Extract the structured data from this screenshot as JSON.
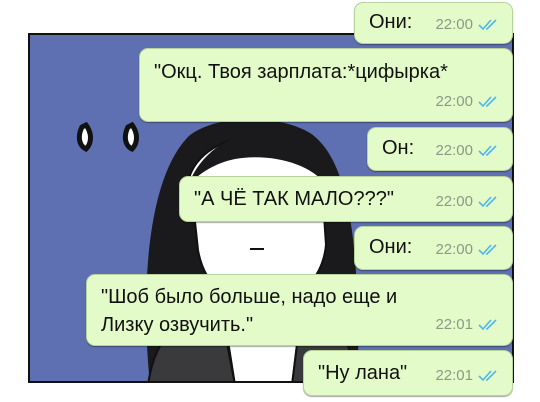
{
  "messages": [
    {
      "lines": [
        "Они:"
      ],
      "time": "22:00",
      "status_icon": "double-check-icon"
    },
    {
      "lines": [
        "\"Окц. Твоя зарплата:*цифырка*"
      ],
      "time": "22:00",
      "status_icon": "double-check-icon"
    },
    {
      "lines": [
        "Он:"
      ],
      "time": "22:00",
      "status_icon": "double-check-icon"
    },
    {
      "lines": [
        "\"А ЧЁ ТАК МАЛО???\""
      ],
      "time": "22:00",
      "status_icon": "double-check-icon"
    },
    {
      "lines": [
        "Они:"
      ],
      "time": "22:00",
      "status_icon": "double-check-icon"
    },
    {
      "lines": [
        "\"Шоб было больше, надо еще и",
        "Лизку озвучить.\""
      ],
      "time": "22:01",
      "status_icon": "double-check-icon"
    },
    {
      "lines": [
        "\"Ну лана\""
      ],
      "time": "22:01",
      "status_icon": "double-check-icon"
    }
  ],
  "colors": {
    "bubble_bg": "#e3fbc9",
    "panel_bg": "#5e6fb2",
    "tick": "#4fb6ec",
    "meta_text": "#8b9a84"
  }
}
